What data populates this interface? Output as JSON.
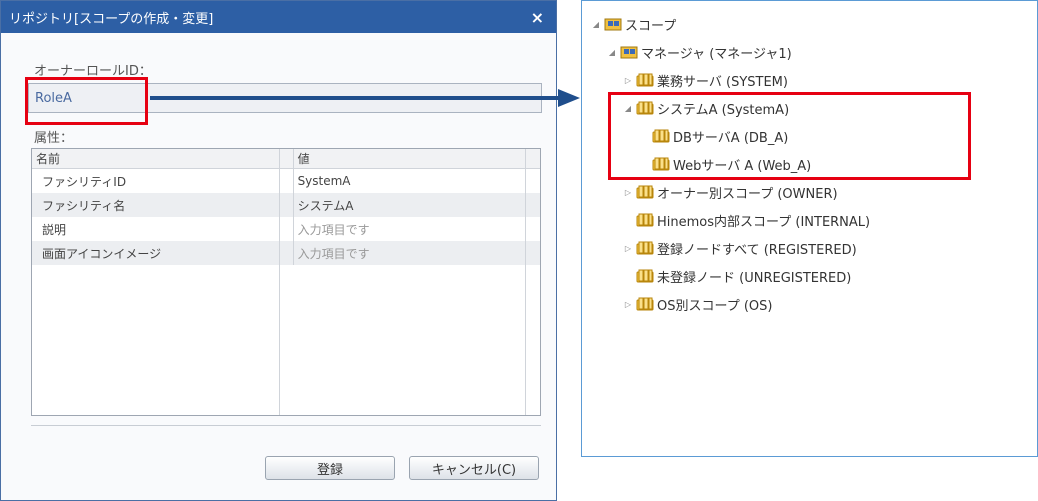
{
  "dialog": {
    "title": "リポジトリ[スコープの作成・変更]",
    "close_label": "×",
    "owner_label": "オーナーロールID：",
    "owner_value": "RoleA",
    "attr_label": "属性：",
    "grid": {
      "col_name": "名前",
      "col_value": "値",
      "rows": [
        {
          "name": "ファシリティID",
          "value": "SystemA"
        },
        {
          "name": "ファシリティ名",
          "value": "システムA"
        },
        {
          "name": "説明",
          "value": "入力項目です"
        },
        {
          "name": "画面アイコンイメージ",
          "value": "入力項目です"
        }
      ]
    },
    "save_label": "登録",
    "cancel_label": "キャンセル(C)"
  },
  "tree": {
    "nodes": [
      {
        "label": "スコープ",
        "icon": "scope-root-icon"
      },
      {
        "label": "マネージャ (マネージャ1)",
        "icon": "manager-icon"
      },
      {
        "label": "業務サーバ (SYSTEM)",
        "icon": "scope-folder-icon"
      },
      {
        "label": "システムA (SystemA)",
        "icon": "scope-folder-icon"
      },
      {
        "label": "DBサーバA (DB_A)",
        "icon": "scope-folder-icon"
      },
      {
        "label": "Webサーバ A (Web_A)",
        "icon": "scope-folder-icon"
      },
      {
        "label": "オーナー別スコープ (OWNER)",
        "icon": "scope-folder-icon"
      },
      {
        "label": "Hinemos内部スコープ (INTERNAL)",
        "icon": "scope-folder-icon"
      },
      {
        "label": "登録ノードすべて (REGISTERED)",
        "icon": "scope-folder-icon"
      },
      {
        "label": "未登録ノード (UNREGISTERED)",
        "icon": "scope-folder-icon"
      },
      {
        "label": "OS別スコープ (OS)",
        "icon": "scope-folder-icon"
      }
    ]
  },
  "colors": {
    "accent": "#2d5fa5",
    "highlight": "#e60012",
    "arrow": "#1f4e8c"
  }
}
